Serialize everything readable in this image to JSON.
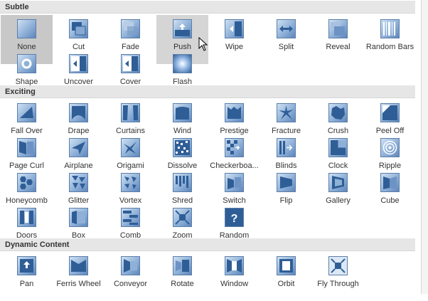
{
  "sections": {
    "subtle": {
      "title": "Subtle",
      "items": [
        {
          "label": "None",
          "icon": "none-icon"
        },
        {
          "label": "Cut",
          "icon": "cut-icon"
        },
        {
          "label": "Fade",
          "icon": "fade-icon"
        },
        {
          "label": "Push",
          "icon": "push-icon"
        },
        {
          "label": "Wipe",
          "icon": "wipe-icon"
        },
        {
          "label": "Split",
          "icon": "split-icon"
        },
        {
          "label": "Reveal",
          "icon": "reveal-icon"
        },
        {
          "label": "Random Bars",
          "icon": "random-bars-icon"
        },
        {
          "label": "Shape",
          "icon": "shape-icon"
        },
        {
          "label": "Uncover",
          "icon": "uncover-icon"
        },
        {
          "label": "Cover",
          "icon": "cover-icon"
        },
        {
          "label": "Flash",
          "icon": "flash-icon"
        }
      ]
    },
    "exciting": {
      "title": "Exciting",
      "items": [
        {
          "label": "Fall Over",
          "icon": "fall-over-icon"
        },
        {
          "label": "Drape",
          "icon": "drape-icon"
        },
        {
          "label": "Curtains",
          "icon": "curtains-icon"
        },
        {
          "label": "Wind",
          "icon": "wind-icon"
        },
        {
          "label": "Prestige",
          "icon": "prestige-icon"
        },
        {
          "label": "Fracture",
          "icon": "fracture-icon"
        },
        {
          "label": "Crush",
          "icon": "crush-icon"
        },
        {
          "label": "Peel Off",
          "icon": "peel-off-icon"
        },
        {
          "label": "Page Curl",
          "icon": "page-curl-icon"
        },
        {
          "label": "Airplane",
          "icon": "airplane-icon"
        },
        {
          "label": "Origami",
          "icon": "origami-icon"
        },
        {
          "label": "Dissolve",
          "icon": "dissolve-icon"
        },
        {
          "label": "Checkerboa...",
          "icon": "checkerboard-icon"
        },
        {
          "label": "Blinds",
          "icon": "blinds-icon"
        },
        {
          "label": "Clock",
          "icon": "clock-icon"
        },
        {
          "label": "Ripple",
          "icon": "ripple-icon"
        },
        {
          "label": "Honeycomb",
          "icon": "honeycomb-icon"
        },
        {
          "label": "Glitter",
          "icon": "glitter-icon"
        },
        {
          "label": "Vortex",
          "icon": "vortex-icon"
        },
        {
          "label": "Shred",
          "icon": "shred-icon"
        },
        {
          "label": "Switch",
          "icon": "switch-icon"
        },
        {
          "label": "Flip",
          "icon": "flip-icon"
        },
        {
          "label": "Gallery",
          "icon": "gallery-icon"
        },
        {
          "label": "Cube",
          "icon": "cube-icon"
        },
        {
          "label": "Doors",
          "icon": "doors-icon"
        },
        {
          "label": "Box",
          "icon": "box-icon"
        },
        {
          "label": "Comb",
          "icon": "comb-icon"
        },
        {
          "label": "Zoom",
          "icon": "zoom-icon"
        },
        {
          "label": "Random",
          "icon": "random-icon"
        }
      ]
    },
    "dynamic": {
      "title": "Dynamic Content",
      "items": [
        {
          "label": "Pan",
          "icon": "pan-icon"
        },
        {
          "label": "Ferris Wheel",
          "icon": "ferris-wheel-icon"
        },
        {
          "label": "Conveyor",
          "icon": "conveyor-icon"
        },
        {
          "label": "Rotate",
          "icon": "rotate-icon"
        },
        {
          "label": "Window",
          "icon": "window-icon"
        },
        {
          "label": "Orbit",
          "icon": "orbit-icon"
        },
        {
          "label": "Fly Through",
          "icon": "fly-through-icon"
        }
      ]
    }
  },
  "state": {
    "selected": "None",
    "hovered": "Push"
  },
  "colors": {
    "header_bg": "#e6e6e6",
    "selected_bg": "#c8c8c8",
    "thumb_border": "#5b7ea8",
    "thumb_light": "#cfe0f3",
    "thumb_dark": "#5f87bb"
  }
}
